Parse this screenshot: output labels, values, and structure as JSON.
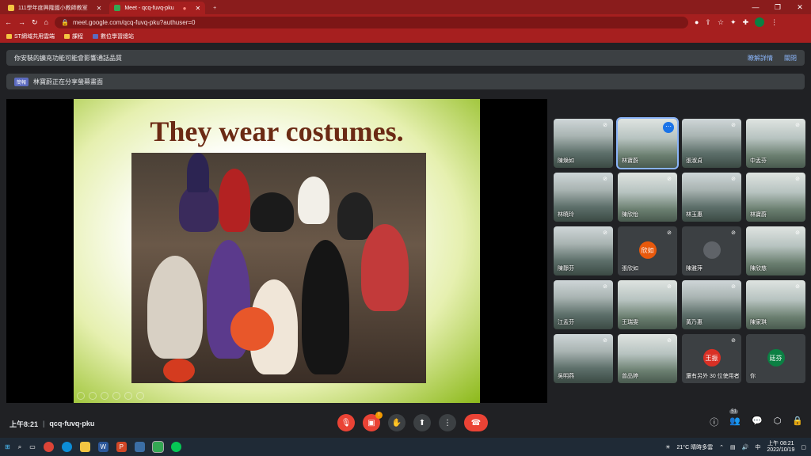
{
  "browser": {
    "tabs": [
      {
        "label": "111學年度興隆國小教師教室",
        "active": false
      },
      {
        "label": "Meet - qcq-fuvq-pku",
        "active": true
      }
    ],
    "url": "meet.google.com/qcq-fuvq-pku?authuser=0",
    "bookmarks": [
      "ST網域共用雲端",
      "課程",
      "數位學習總站"
    ]
  },
  "notices": {
    "extension": {
      "text": "你安裝的擴充功能可能會影響通話品質",
      "links": [
        "瞭解詳情",
        "關閉"
      ]
    },
    "presenting": {
      "badge": "簡報",
      "text": "林寶蔚正在分享螢幕畫面"
    }
  },
  "slide": {
    "title": "They wear costumes."
  },
  "participants": [
    {
      "name": "陳煥如",
      "type": "cam"
    },
    {
      "name": "林寶蔚",
      "type": "cam",
      "speaking": true
    },
    {
      "name": "張淑貞",
      "type": "cam"
    },
    {
      "name": "中孟芬",
      "type": "cam"
    },
    {
      "name": "林曉玲",
      "type": "cam"
    },
    {
      "name": "陳欣怡",
      "type": "cam"
    },
    {
      "name": "林玉惠",
      "type": "cam"
    },
    {
      "name": "林寶蔚",
      "type": "cam"
    },
    {
      "name": "陳靜芬",
      "type": "cam"
    },
    {
      "name": "張欣如",
      "type": "avatar",
      "avatar": "欣如",
      "color": "#e8590c"
    },
    {
      "name": "陳雅萍",
      "type": "avatar",
      "avatar": "",
      "color": "#5f6368"
    },
    {
      "name": "陳欣慈",
      "type": "cam"
    },
    {
      "name": "江孟芬",
      "type": "cam"
    },
    {
      "name": "王瑞雯",
      "type": "cam"
    },
    {
      "name": "黃乃惠",
      "type": "cam"
    },
    {
      "name": "陳家琪",
      "type": "cam"
    },
    {
      "name": "吳明燕",
      "type": "cam"
    },
    {
      "name": "曾品婷",
      "type": "cam"
    },
    {
      "name": "還有另外 30 位使用者",
      "type": "others",
      "avatar": "王振",
      "color": "#d93025"
    },
    {
      "name": "你",
      "type": "self",
      "avatar": "廷芬",
      "color": "#0b8043"
    }
  ],
  "meeting": {
    "time": "上午8:21",
    "code": "qcq-fuvq-pku",
    "participant_count": "51"
  },
  "taskbar": {
    "weather": "21°C  晴時多雲",
    "time": "上午 08:21",
    "date": "2022/10/19",
    "lang": "中"
  }
}
